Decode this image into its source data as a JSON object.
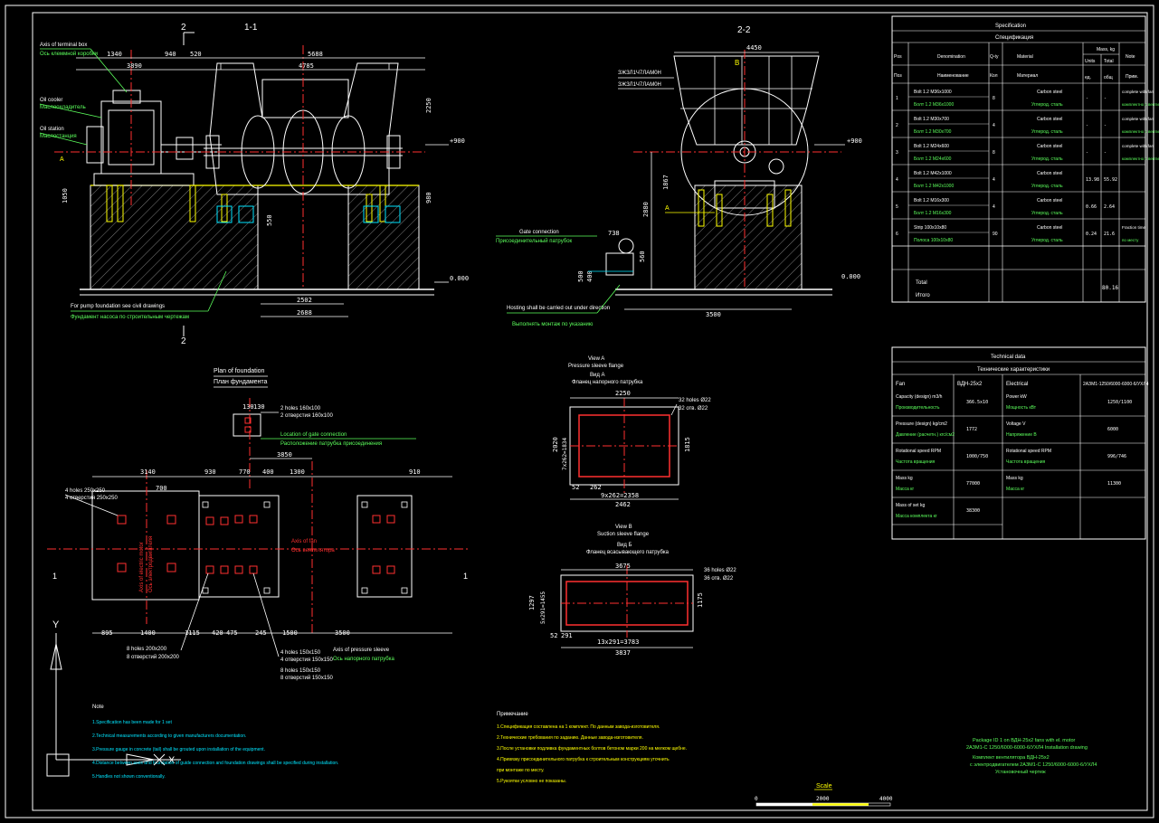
{
  "section_11": {
    "cut_marker": "2",
    "title": "1-1",
    "cut_marker_bottom": "2"
  },
  "section_22": {
    "title": "2-2"
  },
  "callouts_11": {
    "terminal_box_en": "Axis of terminal box",
    "terminal_box_ru": "Ось клеммной коробки",
    "oil_cooler_en": "Oil cooler",
    "oil_cooler_ru": "Маслоохладитель",
    "oil_station_en": "Oil station",
    "oil_station_ru": "Маслостанция",
    "foundation_note_en": "For pump foundation see civil drawings",
    "foundation_note_ru": "Фундамент насоса по строительным чертежам"
  },
  "callouts_22": {
    "mark_a": "ЗЖЗЛ1Ч7ЛАМ0Н",
    "mark_b": "ЗЖЗЛ1Ч7ЛАМ0Н",
    "gate_en": "Gate connection",
    "gate_ru": "Присоединительный патрубок",
    "hosting_en": "Hosting shall be carried out under direction",
    "hosting_ru": "Выполнять монтаж по указанию"
  },
  "dims_11": {
    "d1340": "1340",
    "d940": "940",
    "d520": "520",
    "d5688": "5688",
    "d3890": "3890",
    "d4785": "4785",
    "d2502": "2502",
    "d2688": "2688",
    "d2250": "2250",
    "d1050": "1050",
    "d550": "550",
    "d980": "980",
    "level_top": "+900",
    "level_bot": "0.000",
    "view_a": "A"
  },
  "dims_22": {
    "d4450": "4450",
    "d3500": "3500",
    "d2880": "2880",
    "d1867": "1867",
    "d738": "738",
    "d500": "500",
    "d400": "400",
    "d560": "560",
    "level_top": "+900",
    "level_bot": "0.000",
    "view_b": "B",
    "view_a": "A"
  },
  "plan": {
    "title_en": "Plan of foundation",
    "title_ru": "План фундамента",
    "holes_top_en": "2 holes 160x100",
    "holes_top_ru": "2 отверстия 160x100",
    "gate_loc_en": "Location of gate connection",
    "gate_loc_ru": "Расположение патрубка присоединения",
    "holes_left_en": "4 holes 250x250",
    "holes_left_ru": "4 отверстия 250x250",
    "fan_axis_en": "Axis of fan",
    "fan_axis_ru": "Ось вентилятора",
    "motor_axis_en": "Axis of electric motor",
    "motor_axis_ru": "Ось электродвигателя",
    "holes_200_en": "8 holes 200x200",
    "holes_200_ru": "8 отверстий 200x200",
    "holes_150_en": "4 holes 150x150",
    "holes_150_ru": "4 отверстия 150x150",
    "holes_8_en": "8 holes 150x150",
    "holes_8_ru": "8 отверстий 150x150",
    "pressure_axis_en": "Axis of pressure sleeve",
    "pressure_axis_ru": "Ось напорного патрубка",
    "d3850": "3850",
    "d3140": "3140",
    "d930": "930",
    "d770": "770",
    "d400": "400",
    "d1300": "1300",
    "d700": "700",
    "d895": "895",
    "d1400": "1400",
    "d1115": "1115",
    "d420": "420",
    "d475": "475",
    "d245": "245",
    "d1500": "1500",
    "d3500": "3500",
    "d910": "910",
    "d130a": "130",
    "d130b": "130",
    "axis_y": "Y",
    "axis_x": "X",
    "sec1": "1"
  },
  "view_a": {
    "title1": "View A",
    "title2": "Pressure sleeve flange",
    "title3": "Вид А",
    "title4": "Фланец напорного патрубка",
    "holes_en": "32 holes Ø22",
    "holes_ru": "32 отв. Ø22",
    "d2250": "2250",
    "d2462": "2462",
    "d2338": "9x262=2358",
    "d2020": "2020",
    "d1815": "1815",
    "d262": "262",
    "d52": "52",
    "d7x": "7x262=1834"
  },
  "view_b": {
    "title1": "View B",
    "title2": "Suction sleeve flange",
    "title3": "Вид Б",
    "title4": "Фланец всасывающего патрубка",
    "holes_en": "36 holes Ø22",
    "holes_ru": "36 отв. Ø22",
    "d3675": "3675",
    "d3783": "13x291=3783",
    "d3837": "3837",
    "d1297": "1297",
    "d1175": "1175",
    "d5x": "5x291=1455",
    "d52": "52",
    "d291": "291"
  },
  "spec": {
    "title_en": "Specification",
    "title_ru": "Спецификация",
    "headers": [
      "Pos",
      "Denomination",
      "Q-ty",
      "Material",
      "Mass, kg",
      "Units",
      "Total",
      "Note"
    ],
    "headers_ru": [
      "Поз",
      "Наименование",
      "Кол",
      "Материал",
      "Масса, кг",
      "ед.",
      "общ",
      "Прим."
    ],
    "rows": [
      {
        "pos": "1",
        "name_en": "Bolt 1.2 M36x1000",
        "name_ru": "Болт 1.2 М36x1000",
        "qty": "8",
        "mat_en": "Carbon steel",
        "mat_ru": "Углерод. сталь",
        "unit": "-",
        "total": "-",
        "note_en": "complete with fan",
        "note_ru": "комплектно с вентил."
      },
      {
        "pos": "2",
        "name_en": "Bolt 1.2 M30x700",
        "name_ru": "Болт 1.2 М30x700",
        "qty": "4",
        "mat_en": "Carbon steel",
        "mat_ru": "Углерод. сталь",
        "unit": "-",
        "total": "-",
        "note_en": "complete with fan",
        "note_ru": "комплектно с вентил."
      },
      {
        "pos": "3",
        "name_en": "Bolt 1.2 M24x600",
        "name_ru": "Болт 1.2 М24x600",
        "qty": "8",
        "mat_en": "Carbon steel",
        "mat_ru": "Углерод. сталь",
        "unit": "-",
        "total": "-",
        "note_en": "complete with fan",
        "note_ru": "комплектно с вентил."
      },
      {
        "pos": "4",
        "name_en": "Bolt 1.2 M42x1000",
        "name_ru": "Болт 1.2 М42x1000",
        "qty": "4",
        "mat_en": "Carbon steel",
        "mat_ru": "Углерод. сталь",
        "unit": "13.98",
        "total": "55.92",
        "note_en": "",
        "note_ru": ""
      },
      {
        "pos": "5",
        "name_en": "Bolt 1.2 M16x300",
        "name_ru": "Болт 1.2 М16x300",
        "qty": "4",
        "mat_en": "Carbon steel",
        "mat_ru": "Углерод. сталь",
        "unit": "0.66",
        "total": "2.64",
        "note_en": "",
        "note_ru": ""
      },
      {
        "pos": "6",
        "name_en": "Strip 100x10x80",
        "name_ru": "Полоса 100x10x80",
        "qty": "90",
        "mat_en": "Carbon steel",
        "mat_ru": "Углерод. сталь",
        "unit": "0.24",
        "total": "21.6",
        "note_en": "Fraction time",
        "note_ru": "по месту"
      }
    ],
    "total_en": "Total",
    "total_ru": "Итого",
    "total_value": "80.16"
  },
  "tech": {
    "title_en": "Technical data",
    "title_ru": "Технические характеристики",
    "fan_label": "Fan",
    "fan_value": "ВДН-25х2",
    "motor_label": "Electrical",
    "motor_value": "2АЗМ1-1250/6000-6000-6/УХЛ4",
    "rows_left": [
      {
        "label_en": "Capacity (design) m3/h",
        "label_ru": "Производительность",
        "value": "366.5х10"
      },
      {
        "label_en": "Pressure (design) kg/cm2",
        "label_ru": "Давление (расчетн.) кгс/см2",
        "value": "1772"
      },
      {
        "label_en": "Rotational speed RPM",
        "label_ru": "Частота вращения",
        "value": "1000/750"
      },
      {
        "label_en": "Mass kg",
        "label_ru": "Масса кг",
        "value": "77000"
      },
      {
        "label_en": "Mass of set kg",
        "label_ru": "Масса комплекта кг",
        "value": "38300"
      }
    ],
    "rows_right": [
      {
        "label_en": "Power kW",
        "label_ru": "Мощность кВт",
        "value": "1250/1100"
      },
      {
        "label_en": "Voltage V",
        "label_ru": "Напряжение В",
        "value": "6000"
      },
      {
        "label_en": "Rotational speed RPM",
        "label_ru": "Частота вращения",
        "value": "996/746"
      },
      {
        "label_en": "Mass kg",
        "label_ru": "Масса кг",
        "value": "11300"
      }
    ]
  },
  "notes_en": {
    "title": "Note",
    "items": [
      "1.Specification has been made for 1 set",
      "2.Technical measurements according to given manufacturers documentation.",
      "3.Pressure gauge in concrete (tail) shall be grouted upon installation of the equipment.",
      "4.Distance between axes and foundation of guide connection and foundation drawings shall be specified during installation.",
      "5.Handles not shown conventionally."
    ]
  },
  "notes_ru": {
    "title": "Примечание",
    "items": [
      "1.Спецификация составлена на 1 комплект. По данным завода-изготовителя.",
      "2.Технические требования по заданию. Данные завода-изготовителя.",
      "3.После установки подливка фундаментных болтов бетоном марки 200 на мелком щебне.",
      "4.Привязку присоединительного патрубка к строительным конструкциям уточнить",
      "   при монтаже по месту.",
      "5.Рукоятки условно не показаны."
    ]
  },
  "stamp": {
    "line1": "Package ID 1 on ВДН-25x2 fans with el. motor",
    "line2": "2АЗМ1-С 1250/6000-6000-6/УХЛ4 Installation drawing",
    "line3": "Комплект вентилятора ВДН-25х2",
    "line4": "с электродвигателем 2АЗМ1-С 1250/6000-6000-6/УХЛ4",
    "line5": "Установочный чертеж"
  },
  "scale": {
    "label": "Scale",
    "t0": "0",
    "t1": "2000",
    "t2": "4000"
  }
}
